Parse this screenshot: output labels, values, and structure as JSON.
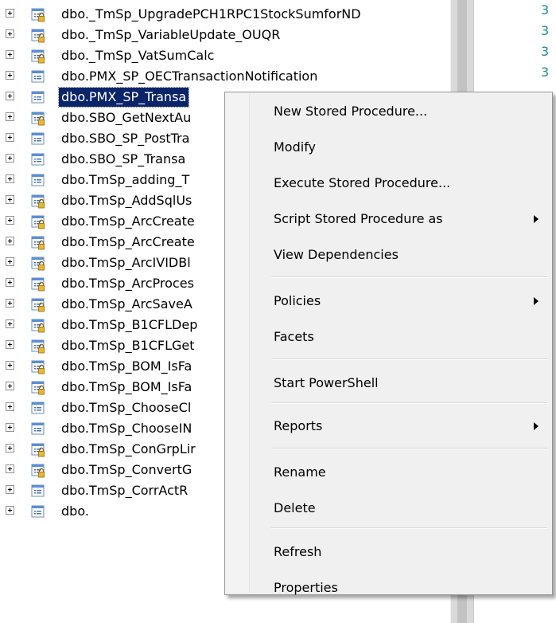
{
  "tree": {
    "rows": [
      {
        "label": "dbo._TmSp_UpgradePCH1RPC1StockSumforND",
        "locked": true
      },
      {
        "label": "dbo._TmSp_VariableUpdate_OUQR",
        "locked": true
      },
      {
        "label": "dbo._TmSp_VatSumCalc",
        "locked": true
      },
      {
        "label": "dbo.PMX_SP_OECTransactionNotification",
        "locked": false
      },
      {
        "label": "dbo.PMX_SP_Transa",
        "locked": false,
        "selected": true
      },
      {
        "label": "dbo.SBO_GetNextAu",
        "locked": true
      },
      {
        "label": "dbo.SBO_SP_PostTra",
        "locked": false
      },
      {
        "label": "dbo.SBO_SP_Transa",
        "locked": false
      },
      {
        "label": "dbo.TmSp_adding_T",
        "locked": false
      },
      {
        "label": "dbo.TmSp_AddSqlUs",
        "locked": true
      },
      {
        "label": "dbo.TmSp_ArcCreate",
        "locked": true
      },
      {
        "label": "dbo.TmSp_ArcCreate",
        "locked": true
      },
      {
        "label": "dbo.TmSp_ArcIVIDBl",
        "locked": true
      },
      {
        "label": "dbo.TmSp_ArcProces",
        "locked": true
      },
      {
        "label": "dbo.TmSp_ArcSaveA",
        "locked": true
      },
      {
        "label": "dbo.TmSp_B1CFLDep",
        "locked": true
      },
      {
        "label": "dbo.TmSp_B1CFLGet",
        "locked": true
      },
      {
        "label": "dbo.TmSp_BOM_IsFa",
        "locked": true
      },
      {
        "label": "dbo.TmSp_BOM_IsFa",
        "locked": true
      },
      {
        "label": "dbo.TmSp_ChooseCl",
        "locked": false
      },
      {
        "label": "dbo.TmSp_ChooseIN",
        "locked": false
      },
      {
        "label": "dbo.TmSp_ConGrpLir",
        "locked": true
      },
      {
        "label": "dbo.TmSp_ConvertG",
        "locked": true
      },
      {
        "label": "dbo.TmSp_CorrActR",
        "locked": false
      },
      {
        "label": "dbo.",
        "locked": false
      }
    ]
  },
  "gutter": {
    "numbers": [
      "3",
      "3",
      "3",
      "3"
    ]
  },
  "context_menu": {
    "items": [
      {
        "label": "New Stored Procedure...",
        "submenu": false
      },
      {
        "label": "Modify",
        "submenu": false
      },
      {
        "label": "Execute Stored Procedure...",
        "submenu": false
      },
      {
        "label": "Script Stored Procedure as",
        "submenu": true
      },
      {
        "label": "View Dependencies",
        "submenu": false
      },
      {
        "label": "Policies",
        "submenu": true
      },
      {
        "label": "Facets",
        "submenu": false
      },
      {
        "label": "Start PowerShell",
        "submenu": false
      },
      {
        "label": "Reports",
        "submenu": true
      },
      {
        "label": "Rename",
        "submenu": false
      },
      {
        "label": "Delete",
        "submenu": false
      },
      {
        "label": "Refresh",
        "submenu": false
      },
      {
        "label": "Properties",
        "submenu": false
      }
    ]
  },
  "colors": {
    "selection": "#0a246a",
    "gutter_text": "#1e8f8f"
  }
}
